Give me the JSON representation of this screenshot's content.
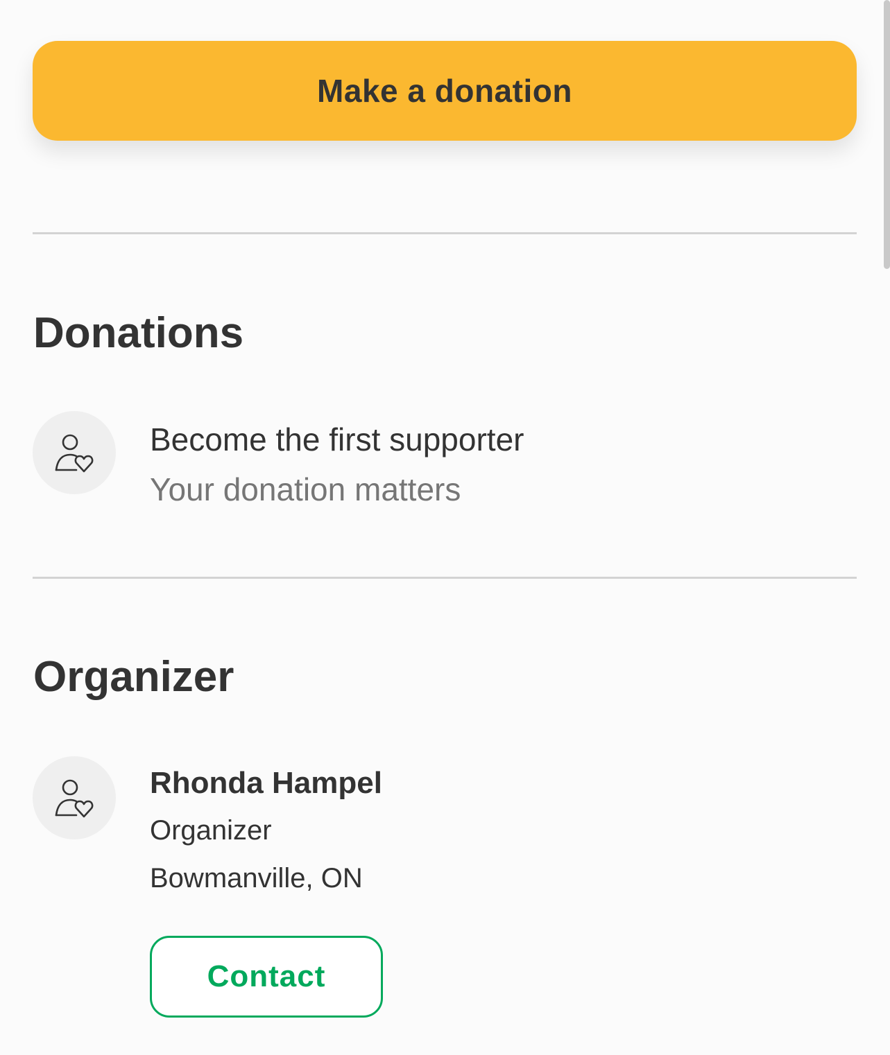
{
  "cta": {
    "donate_label": "Make a donation"
  },
  "donations": {
    "title": "Donations",
    "empty_primary": "Become the first supporter",
    "empty_secondary": "Your donation matters",
    "icon": "person-heart-icon"
  },
  "organizer": {
    "title": "Organizer",
    "name": "Rhonda Hampel",
    "role": "Organizer",
    "location": "Bowmanville, ON",
    "contact_label": "Contact",
    "icon": "person-heart-icon"
  },
  "colors": {
    "cta_background": "#fbb830",
    "accent_green": "#02a95c",
    "text_primary": "#333333",
    "text_secondary": "#767676",
    "avatar_background": "#efefef",
    "divider": "#d3d3d3"
  }
}
